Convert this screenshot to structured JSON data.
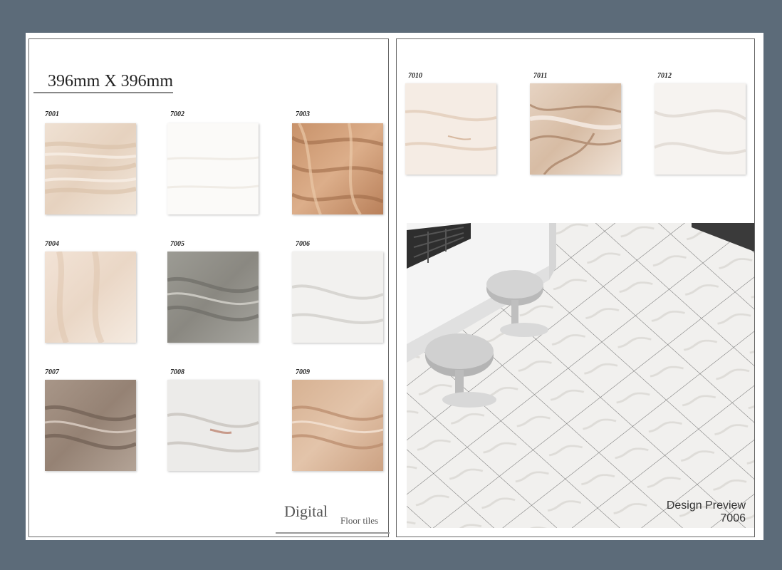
{
  "size_title": "396mm X 396mm",
  "tiles_left": [
    {
      "code": "7001"
    },
    {
      "code": "7002"
    },
    {
      "code": "7003"
    },
    {
      "code": "7004"
    },
    {
      "code": "7005"
    },
    {
      "code": "7006"
    },
    {
      "code": "7007"
    },
    {
      "code": "7008"
    },
    {
      "code": "7009"
    }
  ],
  "tiles_right": [
    {
      "code": "7010"
    },
    {
      "code": "7011"
    },
    {
      "code": "7012"
    }
  ],
  "brand": {
    "main": "Digital",
    "sub": "Floor tiles"
  },
  "preview": {
    "line1": "Design Preview",
    "line2": "7006"
  },
  "colors": {
    "background": "#5c6b79",
    "sheet": "#ffffff"
  }
}
